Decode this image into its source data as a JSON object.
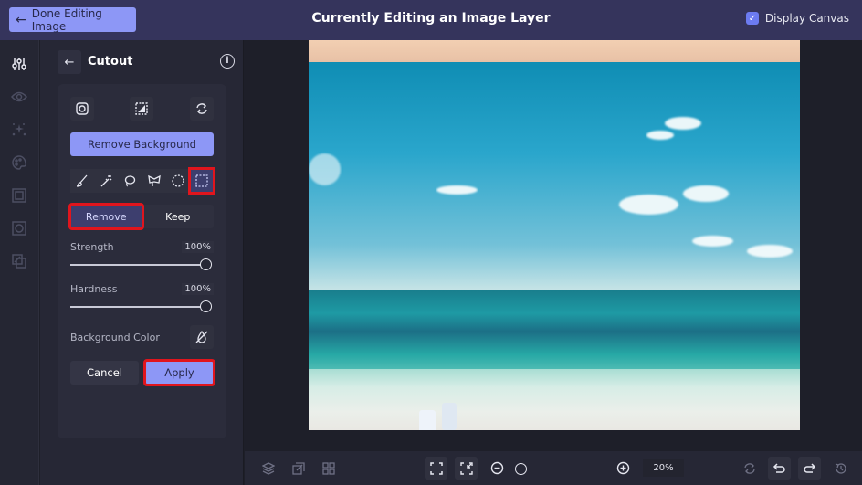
{
  "topbar": {
    "done_label": "Done Editing Image",
    "title": "Currently Editing an Image Layer",
    "display_canvas_label": "Display Canvas",
    "display_canvas_checked": true
  },
  "left_rail": {
    "items": [
      {
        "icon": "sliders-icon",
        "active": true
      },
      {
        "icon": "eye-icon",
        "active": false
      },
      {
        "icon": "sparkles-icon",
        "active": false
      },
      {
        "icon": "palette-icon",
        "active": false
      },
      {
        "icon": "frame-icon",
        "active": false
      },
      {
        "icon": "focus-icon",
        "active": false
      },
      {
        "icon": "layers-overlay-icon",
        "active": false
      }
    ]
  },
  "panel": {
    "title": "Cutout",
    "top_icons": [
      "instagram-icon",
      "erase-background-icon",
      "refresh-icon"
    ],
    "remove_background_label": "Remove Background",
    "tools": [
      "brush-icon",
      "magic-wand-icon",
      "lasso-icon",
      "polygon-lasso-icon",
      "ellipse-select-icon",
      "rect-select-icon"
    ],
    "selected_tool": "rect-select-icon",
    "mode_options": [
      "Remove",
      "Keep"
    ],
    "selected_mode": "Remove",
    "strength": {
      "label": "Strength",
      "value": "100%"
    },
    "hardness": {
      "label": "Hardness",
      "value": "100%"
    },
    "background_color_label": "Background Color",
    "cancel_label": "Cancel",
    "apply_label": "Apply"
  },
  "bottombar": {
    "zoom_value": "20%",
    "zoom_fraction": 0.0
  }
}
